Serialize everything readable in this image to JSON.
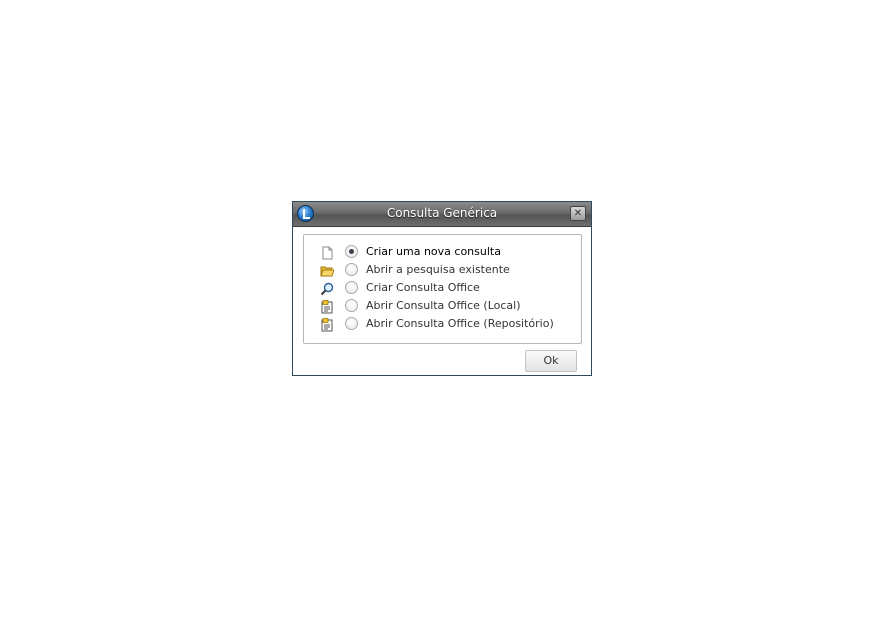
{
  "dialog": {
    "title": "Consulta Genérica",
    "close_symbol": "✕",
    "ok_label": "Ok",
    "options": [
      {
        "label": "Criar uma nova consulta",
        "icon": "blank-document-icon",
        "selected": true
      },
      {
        "label": "Abrir a pesquisa existente",
        "icon": "open-folder-icon",
        "selected": false
      },
      {
        "label": "Criar Consulta Office",
        "icon": "magnifier-icon",
        "selected": false
      },
      {
        "label": "Abrir Consulta Office (Local)",
        "icon": "office-document-icon",
        "selected": false
      },
      {
        "label": "Abrir Consulta Office (Repositório)",
        "icon": "office-document-icon",
        "selected": false
      }
    ]
  },
  "colors": {
    "titlebar": "#6a6a6a",
    "border": "#2c4b5e",
    "radio_dot": "#3a3f4a"
  }
}
